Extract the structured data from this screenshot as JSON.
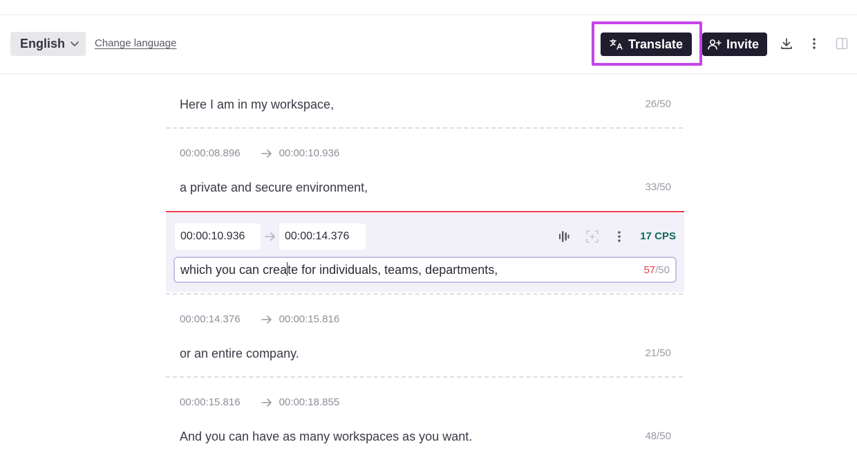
{
  "toolbar": {
    "language": "English",
    "change_language": "Change language",
    "translate_label": "Translate",
    "invite_label": "Invite"
  },
  "segments": [
    {
      "text": "Here I am in my workspace,",
      "count": "26/50"
    },
    {
      "start": "00:00:08.896",
      "end": "00:00:10.936",
      "text": "a private and secure environment,",
      "count": "33/50"
    },
    {
      "start": "00:00:14.376",
      "end": "00:00:15.816",
      "text": "or an entire company.",
      "count": "21/50"
    },
    {
      "start": "00:00:15.816",
      "end": "00:00:18.855",
      "text": "And you can have as many workspaces as you want.",
      "count": "48/50"
    }
  ],
  "active": {
    "start": "00:00:10.936",
    "end": "00:00:14.376",
    "text_before_caret": "which you can crea",
    "text_after_caret": "te for individuals, teams, departments,",
    "cps": "17 CPS",
    "count_value": "57",
    "count_max": "/50"
  },
  "colors": {
    "accent_highlight": "#c544ea",
    "button_dark": "#1f1d2e",
    "cps_green": "#0e6b5a",
    "over_limit_red": "#e53945"
  }
}
